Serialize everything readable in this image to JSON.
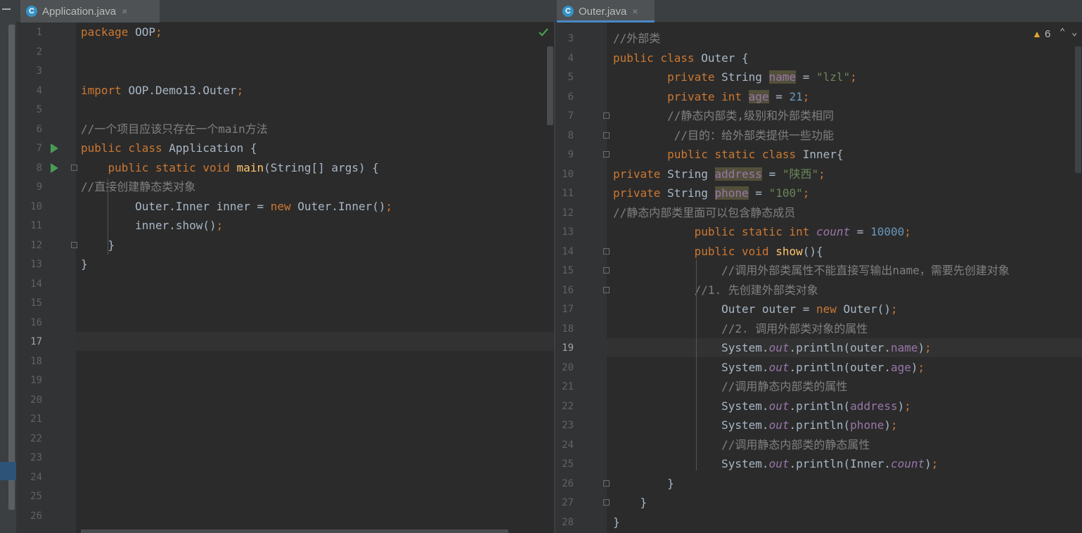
{
  "left_editor": {
    "tab": {
      "label": "Application.java",
      "icon": "class-icon",
      "close": "×"
    },
    "lines": [
      {
        "n": "1",
        "segs": [
          [
            "kw",
            "package "
          ],
          [
            "cls",
            "OOP"
          ],
          [
            "kw",
            ";"
          ]
        ]
      },
      {
        "n": "2",
        "segs": []
      },
      {
        "n": "3",
        "segs": []
      },
      {
        "n": "4",
        "segs": [
          [
            "kw",
            "import "
          ],
          [
            "cls",
            "OOP.Demo13.Outer"
          ],
          [
            "kw",
            ";"
          ]
        ]
      },
      {
        "n": "5",
        "segs": []
      },
      {
        "n": "6",
        "segs": [
          [
            "cm",
            "//一个项目应该只存在一个main方法"
          ]
        ]
      },
      {
        "n": "7",
        "segs": [
          [
            "kw",
            "public class "
          ],
          [
            "cls",
            "Application {"
          ]
        ]
      },
      {
        "n": "8",
        "segs": [
          [
            "cls",
            "    "
          ],
          [
            "kw",
            "public static void "
          ],
          [
            "fn",
            "main"
          ],
          [
            "cls",
            "(String[] args) {"
          ]
        ]
      },
      {
        "n": "9",
        "segs": [
          [
            "cm",
            "//直接创建静态类对象"
          ]
        ]
      },
      {
        "n": "10",
        "segs": [
          [
            "cls",
            "        Outer.Inner inner = "
          ],
          [
            "kw",
            "new "
          ],
          [
            "cls",
            "Outer.Inner()"
          ],
          [
            "kw",
            ";"
          ]
        ]
      },
      {
        "n": "11",
        "segs": [
          [
            "cls",
            "        inner.show()"
          ],
          [
            "kw",
            ";"
          ]
        ]
      },
      {
        "n": "12",
        "segs": [
          [
            "cls",
            "    }"
          ]
        ]
      },
      {
        "n": "13",
        "segs": [
          [
            "cls",
            "}"
          ]
        ]
      },
      {
        "n": "14",
        "segs": []
      },
      {
        "n": "15",
        "segs": []
      },
      {
        "n": "16",
        "segs": []
      },
      {
        "n": "17",
        "segs": []
      },
      {
        "n": "18",
        "segs": []
      },
      {
        "n": "19",
        "segs": []
      },
      {
        "n": "20",
        "segs": []
      },
      {
        "n": "21",
        "segs": []
      },
      {
        "n": "22",
        "segs": []
      },
      {
        "n": "23",
        "segs": []
      },
      {
        "n": "24",
        "segs": []
      },
      {
        "n": "25",
        "segs": []
      },
      {
        "n": "26",
        "segs": []
      }
    ],
    "current_line": "17"
  },
  "right_editor": {
    "tab": {
      "label": "Outer.java",
      "icon": "class-icon",
      "close": "×"
    },
    "warnings": {
      "icon": "warning-icon",
      "count": "6"
    },
    "lines": [
      {
        "n": "3",
        "segs": [
          [
            "cm",
            "//外部类"
          ]
        ]
      },
      {
        "n": "4",
        "segs": [
          [
            "kw",
            "public class "
          ],
          [
            "cls",
            "Outer {"
          ]
        ]
      },
      {
        "n": "5",
        "segs": [
          [
            "cls",
            "        "
          ],
          [
            "kw",
            "private "
          ],
          [
            "cls",
            "String "
          ],
          [
            "fldhl",
            "name"
          ],
          [
            "cls",
            " = "
          ],
          [
            "str",
            "\"lzl\""
          ],
          [
            "kw",
            ";"
          ]
        ]
      },
      {
        "n": "6",
        "segs": [
          [
            "cls",
            "        "
          ],
          [
            "kw",
            "private int "
          ],
          [
            "fldhl",
            "age"
          ],
          [
            "cls",
            " = "
          ],
          [
            "num",
            "21"
          ],
          [
            "kw",
            ";"
          ]
        ]
      },
      {
        "n": "7",
        "segs": [
          [
            "cls",
            "        "
          ],
          [
            "cm",
            "//静态内部类,级别和外部类相同"
          ]
        ]
      },
      {
        "n": "8",
        "segs": [
          [
            "cls",
            "         "
          ],
          [
            "cm",
            "//目的：给外部类提供一些功能"
          ]
        ]
      },
      {
        "n": "9",
        "segs": [
          [
            "cls",
            "        "
          ],
          [
            "kw",
            "public static class "
          ],
          [
            "cls",
            "Inner{"
          ]
        ]
      },
      {
        "n": "10",
        "segs": [
          [
            "kw",
            "private "
          ],
          [
            "cls",
            "String "
          ],
          [
            "fldhl",
            "address"
          ],
          [
            "cls",
            " = "
          ],
          [
            "str",
            "\"陕西\""
          ],
          [
            "kw",
            ";"
          ]
        ]
      },
      {
        "n": "11",
        "segs": [
          [
            "kw",
            "private "
          ],
          [
            "cls",
            "String "
          ],
          [
            "fldhl",
            "phone"
          ],
          [
            "cls",
            " = "
          ],
          [
            "str",
            "\"100\""
          ],
          [
            "kw",
            ";"
          ]
        ]
      },
      {
        "n": "12",
        "segs": [
          [
            "cm",
            "//静态内部类里面可以包含静态成员"
          ]
        ]
      },
      {
        "n": "13",
        "segs": [
          [
            "cls",
            "            "
          ],
          [
            "kw",
            "public static int "
          ],
          [
            "ital",
            "count"
          ],
          [
            "cls",
            " = "
          ],
          [
            "num",
            "10000"
          ],
          [
            "kw",
            ";"
          ]
        ]
      },
      {
        "n": "14",
        "segs": [
          [
            "cls",
            "            "
          ],
          [
            "kw",
            "public void "
          ],
          [
            "fn",
            "show"
          ],
          [
            "cls",
            "(){"
          ]
        ]
      },
      {
        "n": "15",
        "segs": [
          [
            "cls",
            "                "
          ],
          [
            "cm",
            "//调用外部类属性不能直接写输出name，需要先创建对象"
          ]
        ]
      },
      {
        "n": "16",
        "segs": [
          [
            "cls",
            "            "
          ],
          [
            "cm",
            "//1. 先创建外部类对象"
          ]
        ]
      },
      {
        "n": "17",
        "segs": [
          [
            "cls",
            "                Outer outer = "
          ],
          [
            "kw",
            "new "
          ],
          [
            "cls",
            "Outer()"
          ],
          [
            "kw",
            ";"
          ]
        ]
      },
      {
        "n": "18",
        "segs": [
          [
            "cls",
            "                "
          ],
          [
            "cm",
            "//2. 调用外部类对象的属性"
          ]
        ]
      },
      {
        "n": "19",
        "segs": [
          [
            "cls",
            "                System."
          ],
          [
            "ital",
            "out"
          ],
          [
            "cls",
            ".println(outer."
          ],
          [
            "fld",
            "name"
          ],
          [
            "cls",
            ")"
          ],
          [
            "kw",
            ";"
          ]
        ]
      },
      {
        "n": "20",
        "segs": [
          [
            "cls",
            "                System."
          ],
          [
            "ital",
            "out"
          ],
          [
            "cls",
            ".println(outer."
          ],
          [
            "fld",
            "age"
          ],
          [
            "cls",
            ")"
          ],
          [
            "kw",
            ";"
          ]
        ]
      },
      {
        "n": "21",
        "segs": [
          [
            "cls",
            "                "
          ],
          [
            "cm",
            "//调用静态内部类的属性"
          ]
        ]
      },
      {
        "n": "22",
        "segs": [
          [
            "cls",
            "                System."
          ],
          [
            "ital",
            "out"
          ],
          [
            "cls",
            ".println("
          ],
          [
            "fld",
            "address"
          ],
          [
            "cls",
            ")"
          ],
          [
            "kw",
            ";"
          ]
        ]
      },
      {
        "n": "23",
        "segs": [
          [
            "cls",
            "                System."
          ],
          [
            "ital",
            "out"
          ],
          [
            "cls",
            ".println("
          ],
          [
            "fld",
            "phone"
          ],
          [
            "cls",
            ")"
          ],
          [
            "kw",
            ";"
          ]
        ]
      },
      {
        "n": "24",
        "segs": [
          [
            "cls",
            "                "
          ],
          [
            "cm",
            "//调用静态内部类的静态属性"
          ]
        ]
      },
      {
        "n": "25",
        "segs": [
          [
            "cls",
            "                System."
          ],
          [
            "ital",
            "out"
          ],
          [
            "cls",
            ".println(Inner."
          ],
          [
            "ital",
            "count"
          ],
          [
            "cls",
            ")"
          ],
          [
            "kw",
            ";"
          ]
        ]
      },
      {
        "n": "26",
        "segs": [
          [
            "cls",
            "        }"
          ]
        ]
      },
      {
        "n": "27",
        "segs": [
          [
            "cls",
            "    }"
          ]
        ]
      },
      {
        "n": "28",
        "segs": [
          [
            "cls",
            "}"
          ]
        ]
      }
    ],
    "current_line": "19"
  },
  "colors": {
    "keyword": "#cc7832",
    "string": "#6a8759",
    "number": "#6897bb",
    "comment": "#808080",
    "field": "#9876aa",
    "method": "#ffc66d",
    "background": "#2b2b2b"
  }
}
